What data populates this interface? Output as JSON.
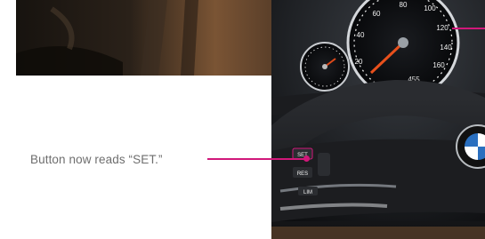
{
  "caption": {
    "text": "Button now reads “SET.”"
  },
  "speedometer": {
    "ticks": [
      "20",
      "40",
      "60",
      "80",
      "100",
      "120",
      "140",
      "160"
    ],
    "odometer": "455"
  },
  "wheel_buttons": {
    "set": "SET",
    "res": "RES",
    "lim": "LIM"
  },
  "colors": {
    "callout": "#d1187a",
    "caption": "#6e6e6e"
  },
  "icons": [
    "bmw-logo-icon"
  ]
}
